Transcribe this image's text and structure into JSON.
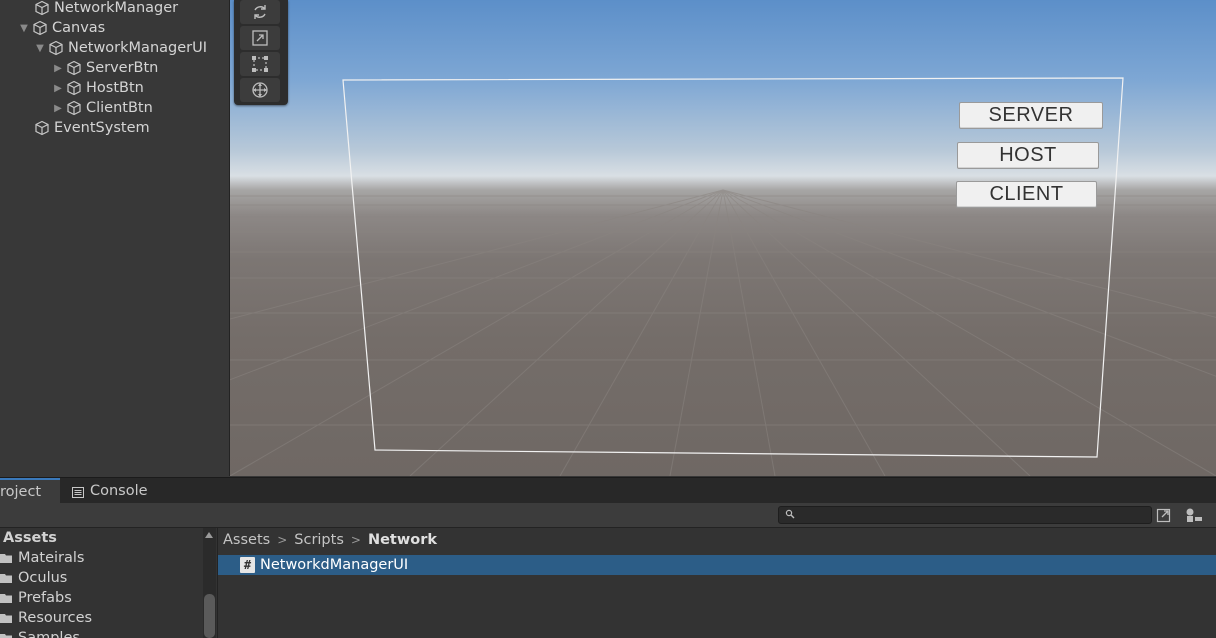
{
  "hierarchy": {
    "items": [
      {
        "label": "NetworkManager",
        "icon": "cube-icon"
      },
      {
        "label": "Canvas",
        "icon": "cube-icon",
        "expanded": true
      },
      {
        "label": "NetworkManagerUI",
        "icon": "cube-icon",
        "expanded": true
      },
      {
        "label": "ServerBtn",
        "icon": "cube-icon",
        "expanded": false
      },
      {
        "label": "HostBtn",
        "icon": "cube-icon",
        "expanded": false
      },
      {
        "label": "ClientBtn",
        "icon": "cube-icon",
        "expanded": false
      },
      {
        "label": "EventSystem",
        "icon": "cube-icon"
      }
    ]
  },
  "scene": {
    "tools": [
      "rotate-tool-icon",
      "scale-tool-icon",
      "rect-tool-icon",
      "transform-tool-icon"
    ],
    "buttons": {
      "server": "SERVER",
      "host": "HOST",
      "client": "CLIENT"
    }
  },
  "bottom": {
    "tabs": {
      "project": "roject",
      "console": "Console"
    },
    "search": {
      "placeholder": ""
    },
    "folders": {
      "root": "Assets",
      "items": [
        "Mateirals",
        "Oculus",
        "Prefabs",
        "Resources",
        "Samples"
      ]
    },
    "breadcrumb": [
      "Assets",
      "Scripts",
      "Network"
    ],
    "files": [
      {
        "name": "NetworkdManagerUI",
        "icon": "csharp-script-icon",
        "selected": true
      }
    ]
  },
  "colors": {
    "selection": "#2c5d87",
    "tab_accent": "#3a79bb",
    "panel": "#383838"
  }
}
